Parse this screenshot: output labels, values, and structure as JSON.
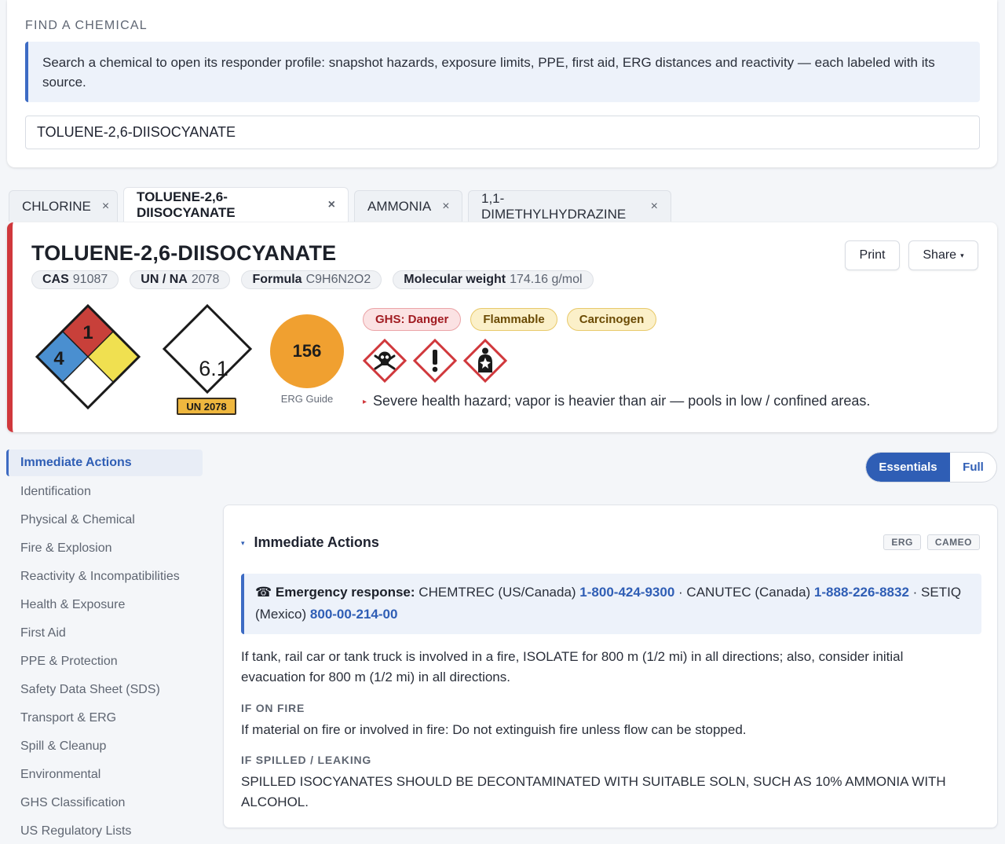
{
  "search": {
    "title": "FIND A CHEMICAL",
    "info": "Search a chemical to open its responder profile: snapshot hazards, exposure limits, PPE, first aid, ERG distances and reactivity — each labeled with its source.",
    "value": "TOLUENE-2,6-DIISOCYANATE"
  },
  "tabs": [
    {
      "label": "CHLORINE",
      "close": "×"
    },
    {
      "label": "TOLUENE-2,6-DIISOCYANATE",
      "close": "×",
      "active": true
    },
    {
      "label": "AMMONIA",
      "close": "×"
    },
    {
      "label": "1,1-DIMETHYLHYDRAZINE",
      "close": "×"
    }
  ],
  "chemical": {
    "name": "TOLUENE-2,6-DIISOCYANATE",
    "chips": [
      {
        "label": "CAS",
        "value": "91087"
      },
      {
        "label": "UN / NA",
        "value": "2078"
      },
      {
        "label": "Formula",
        "value": "C9H6N2O2"
      },
      {
        "label": "Molecular weight",
        "value": "174.16 g/mol"
      }
    ],
    "print_label": "Print",
    "share_label": "Share",
    "share_caret": "▾",
    "nfpa": {
      "health": "4",
      "flammability": "1",
      "instability": "",
      "special": ""
    },
    "dot_class": "6.1",
    "un_badge": "UN 2078",
    "erg_guide": "156",
    "erg_label": "ERG Guide",
    "ghs_signal": "GHS:  Danger",
    "badges": [
      "Flammable",
      "Carcinogen"
    ],
    "pictograms": [
      "skull-crossbones-icon",
      "exclamation-icon",
      "health-hazard-icon"
    ],
    "hazard_note": "Severe health hazard; vapor is heavier than air — pools in low / confined areas.",
    "hazard_note_marker": "▸"
  },
  "sidebar": {
    "items": [
      {
        "label": "Immediate Actions",
        "active": true
      },
      {
        "label": "Identification"
      },
      {
        "label": "Physical & Chemical"
      },
      {
        "label": "Fire & Explosion"
      },
      {
        "label": "Reactivity & Incompatibilities"
      },
      {
        "label": "Health & Exposure"
      },
      {
        "label": "First Aid"
      },
      {
        "label": "PPE & Protection"
      },
      {
        "label": "Safety Data Sheet (SDS)"
      },
      {
        "label": "Transport & ERG"
      },
      {
        "label": "Spill & Cleanup"
      },
      {
        "label": "Environmental"
      },
      {
        "label": "GHS Classification"
      },
      {
        "label": "US Regulatory Lists"
      }
    ]
  },
  "view_toggle": {
    "essentials": "Essentials",
    "full": "Full",
    "selected": "Essentials"
  },
  "panel": {
    "caret": "▾",
    "title": "Immediate Actions",
    "sources": [
      "ERG",
      "CAMEO"
    ],
    "emergency": {
      "icon": "☎",
      "label": "Emergency response:",
      "chemtrec_text": "CHEMTREC (US/Canada)",
      "chemtrec_phone": "1-800-424-9300",
      "sep1": "·",
      "canutec_text": "CANUTEC (Canada)",
      "canutec_phone": "1-888-226-8832",
      "sep2": "·",
      "setiq_text": "SETIQ (Mexico)",
      "setiq_phone": "800-00-214-00"
    },
    "isolate_text": "If tank, rail car or tank truck is involved in a fire, ISOLATE for 800 m (1/2 mi) in all directions; also, consider initial evacuation for 800 m (1/2 mi) in all directions.",
    "fire_heading": "IF ON FIRE",
    "fire_text": "If material on fire or involved in fire: Do not extinguish fire unless flow can be stopped.",
    "spill_heading": "IF SPILLED / LEAKING",
    "spill_text": "SPILLED ISOCYANATES SHOULD BE DECONTAMINATED WITH SUITABLE SOLN, SUCH AS 10% AMMONIA WITH ALCOHOL."
  },
  "colors": {
    "accent": "#2f5eb5",
    "danger_border": "#d0383c",
    "nfpa_health": "#4a8fd0",
    "nfpa_flammability": "#c8403a",
    "nfpa_instability": "#f0e050",
    "erg_orange": "#f0a030"
  }
}
